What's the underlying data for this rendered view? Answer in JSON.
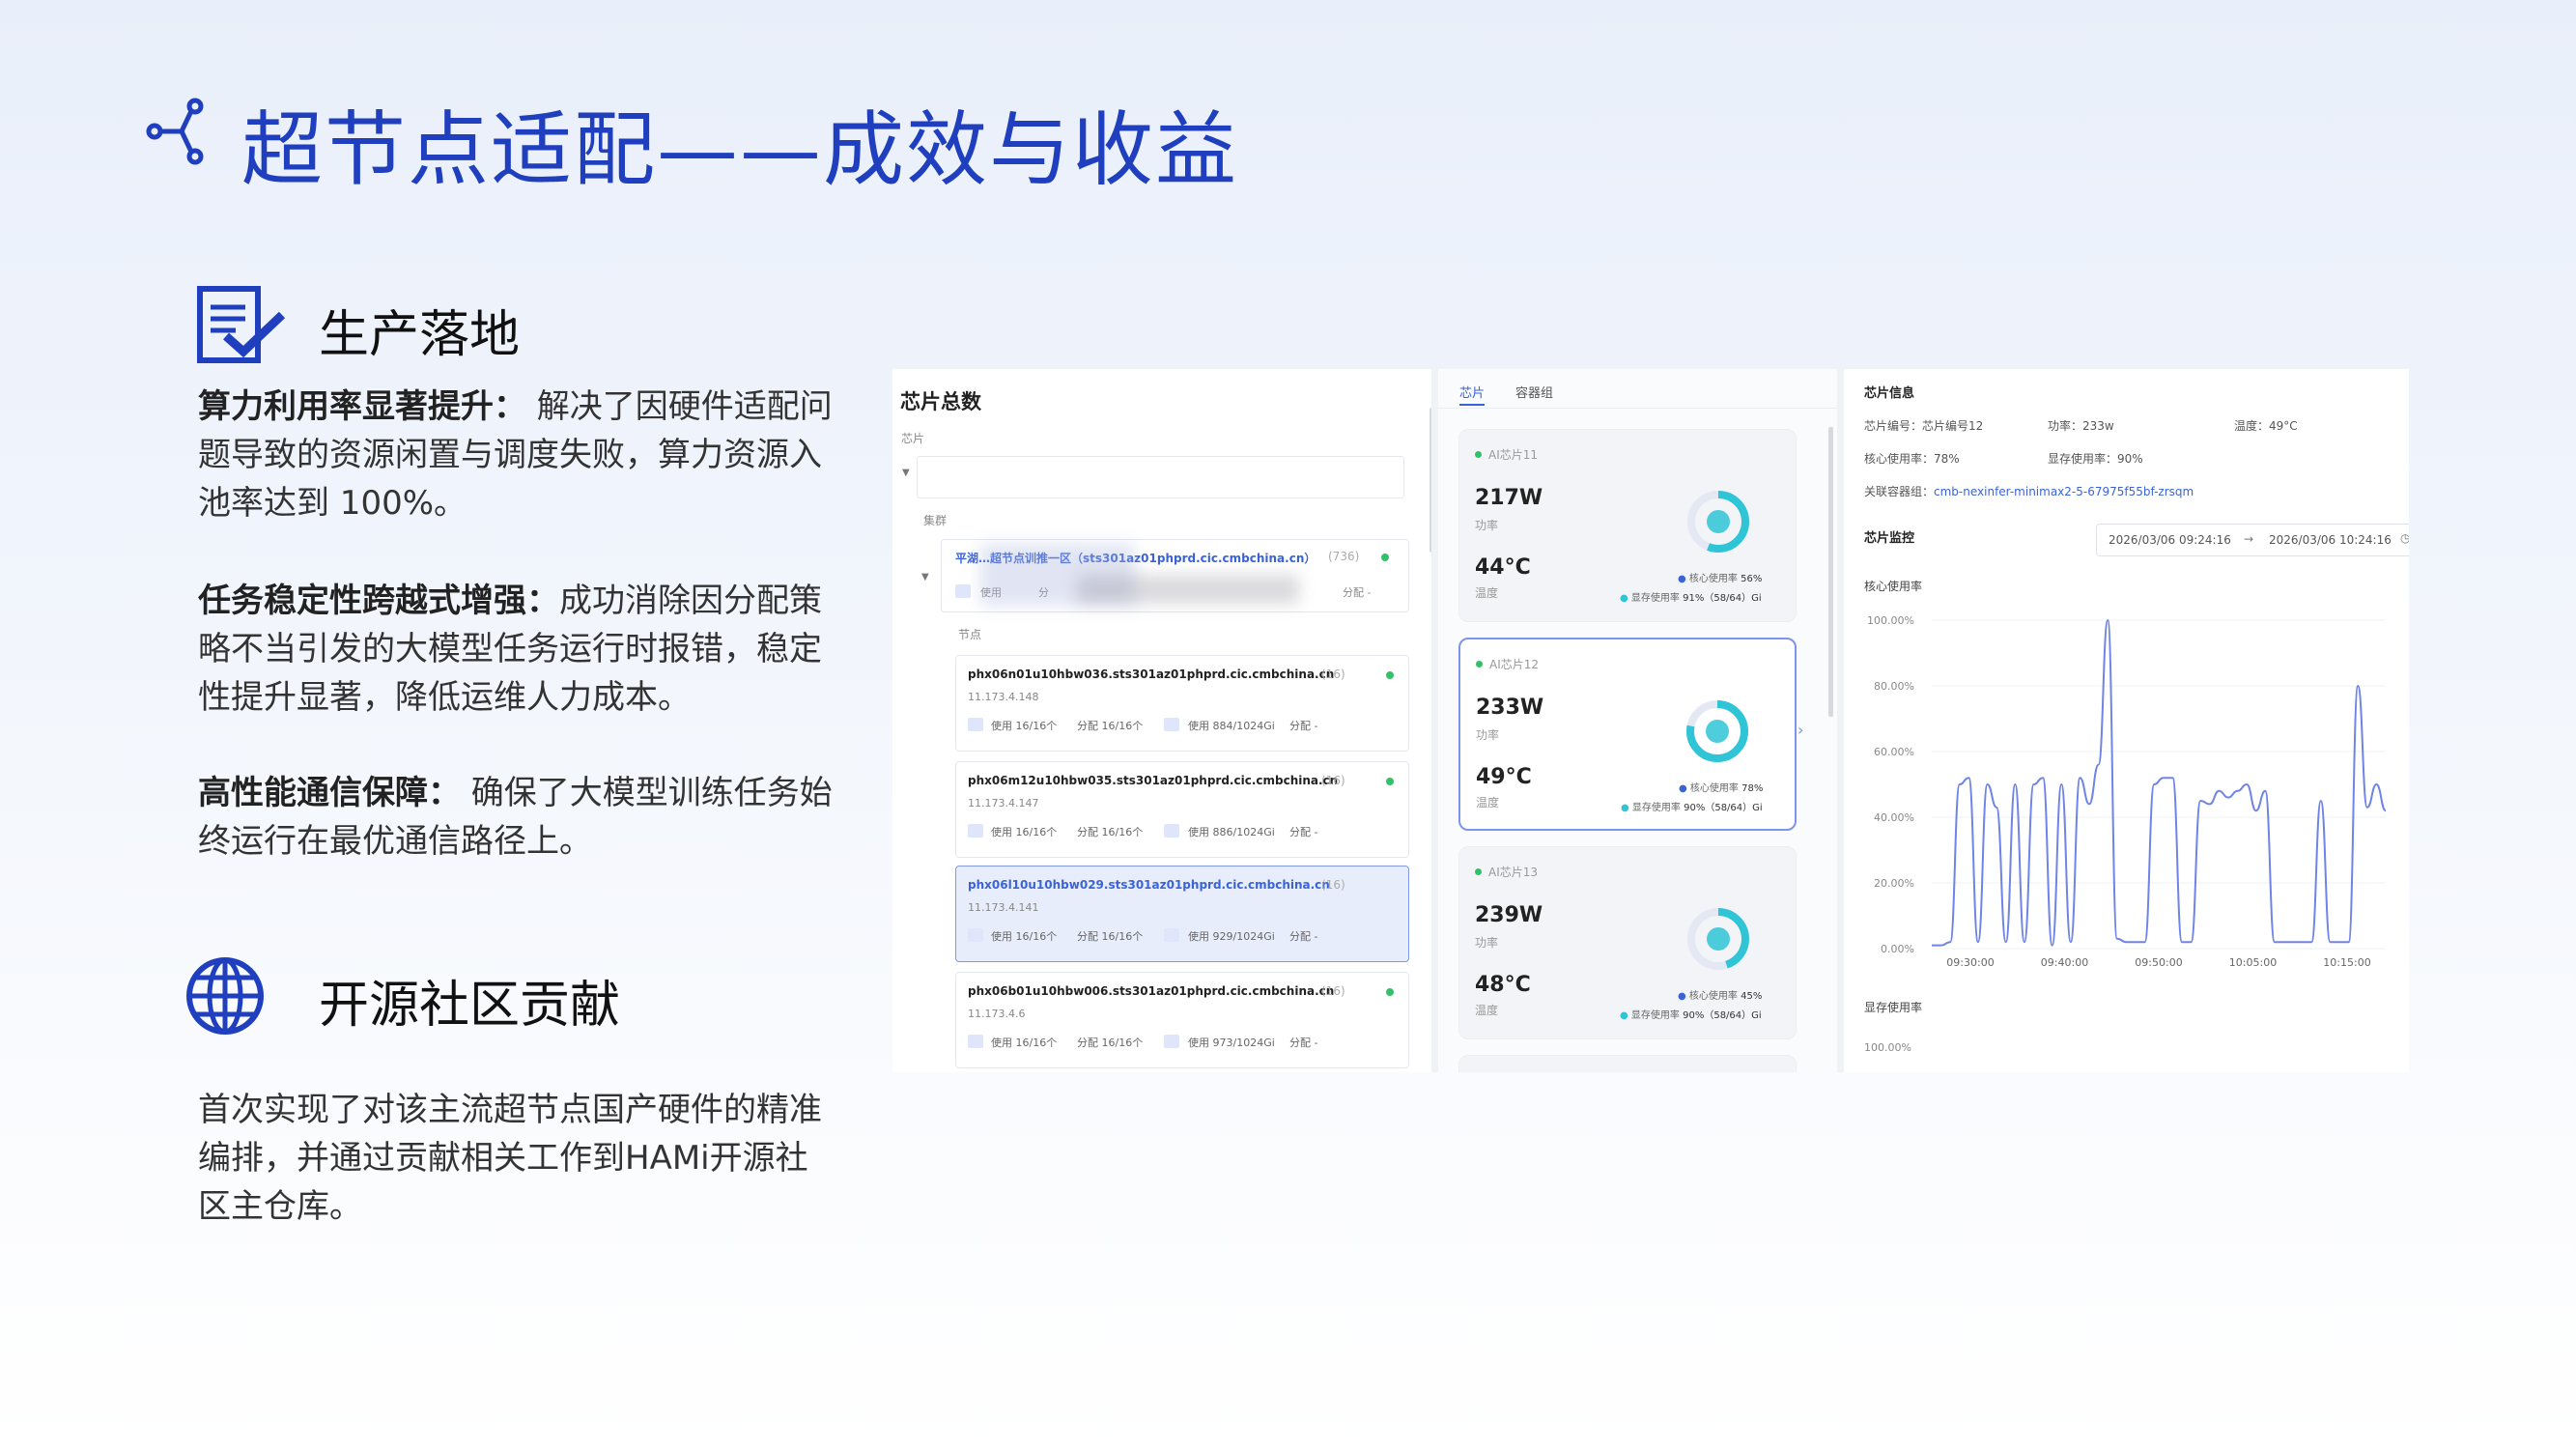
{
  "title": "超节点适配——成效与收益",
  "section1": {
    "heading": "生产落地",
    "items": [
      {
        "label": "算力利用率显著提升：",
        "text": " 解决了因硬件适配问题导致的资源闲置与调度失败，算力资源入池率达到 100%。"
      },
      {
        "label": "任务稳定性跨越式增强：",
        "text": "成功消除因分配策略不当引发的大模型任务运行时报错，稳定性提升显著，降低运维人力成本。"
      },
      {
        "label": "高性能通信保障：",
        "text": " 确保了大模型训练任务始终运行在最优通信路径上。"
      }
    ]
  },
  "section2": {
    "heading": "开源社区贡献",
    "text": "首次实现了对该主流超节点国产硬件的精准编排，并通过贡献相关工作到HAMi开源社区主仓库。"
  },
  "screenshot": {
    "left": {
      "title": "芯片总数",
      "chip_label": "芯片",
      "cluster_label": "集群",
      "cluster": {
        "name": "平湖…超节点训推一区（sts301az01phprd.cic.cmbchina.cn）",
        "count": "(736)",
        "use": "使用",
        "alloc": "分",
        "tail": "分配 -"
      },
      "node_label": "节点",
      "nodes": [
        {
          "name": "phx06n01u10hbw036.sts301az01phprd.cic.cmbchina.cn",
          "count": "(16)",
          "ip": "11.173.4.148",
          "use": "使用 16/16个",
          "alloc": "分配 16/16个",
          "mem": "使用 884/1024Gi",
          "mem_alloc": "分配 -",
          "selected": false
        },
        {
          "name": "phx06m12u10hbw035.sts301az01phprd.cic.cmbchina.cn",
          "count": "(16)",
          "ip": "11.173.4.147",
          "use": "使用 16/16个",
          "alloc": "分配 16/16个",
          "mem": "使用 886/1024Gi",
          "mem_alloc": "分配 -",
          "selected": false
        },
        {
          "name": "phx06l10u10hbw029.sts301az01phprd.cic.cmbchina.cn",
          "count": "(16)",
          "ip": "11.173.4.141",
          "use": "使用 16/16个",
          "alloc": "分配 16/16个",
          "mem": "使用 929/1024Gi",
          "mem_alloc": "分配 -",
          "selected": true
        },
        {
          "name": "phx06b01u10hbw006.sts301az01phprd.cic.cmbchina.cn",
          "count": "(16)",
          "ip": "11.173.4.6",
          "use": "使用 16/16个",
          "alloc": "分配 16/16个",
          "mem": "使用 973/1024Gi",
          "mem_alloc": "分配 -",
          "selected": false
        }
      ]
    },
    "middle": {
      "tabs": [
        "芯片",
        "容器组"
      ],
      "chips": [
        {
          "name": "AI芯片11",
          "power": "217W",
          "power_label": "功率",
          "temp": "44°C",
          "temp_label": "温度",
          "core": "核心使用率",
          "core_val": "56%",
          "mem": "显存使用率",
          "mem_val": "91%（58/64）Gi",
          "core_pct": 0.56,
          "selected": false
        },
        {
          "name": "AI芯片12",
          "power": "233W",
          "power_label": "功率",
          "temp": "49°C",
          "temp_label": "温度",
          "core": "核心使用率",
          "core_val": "78%",
          "mem": "显存使用率",
          "mem_val": "90%（58/64）Gi",
          "core_pct": 0.78,
          "selected": true
        },
        {
          "name": "AI芯片13",
          "power": "239W",
          "power_label": "功率",
          "temp": "48°C",
          "temp_label": "温度",
          "core": "核心使用率",
          "core_val": "45%",
          "mem": "显存使用率",
          "mem_val": "90%（58/64）Gi",
          "core_pct": 0.45,
          "selected": false
        }
      ]
    },
    "right": {
      "info_title": "芯片信息",
      "chip_no": "芯片编号：芯片编号12",
      "power": "功率：233w",
      "temp": "温度：49°C",
      "core": "核心使用率：78%",
      "mem": "显存使用率：90%",
      "container_label": "关联容器组：",
      "container": "cmb-nexinfer-minimax2-5-67975f55bf-zrsqm",
      "monitor_title": "芯片监控",
      "range_start": "2026/03/06 09:24:16",
      "range_sep": "→",
      "range_end": "2026/03/06 10:24:16",
      "chart_title": "核心使用率",
      "chart2_title": "显存使用率",
      "chart2_first_tick": "100.00%"
    },
    "colors": {
      "accent": "#3a63d8",
      "line": "#6f84e6",
      "ok": "#34c06a",
      "ring": "#2fc4d6"
    }
  },
  "chart_data": {
    "type": "line",
    "title": "核心使用率",
    "xlabel": "",
    "ylabel": "",
    "ylim": [
      0,
      100
    ],
    "yticks": [
      "0.00%",
      "20.00%",
      "40.00%",
      "60.00%",
      "80.00%",
      "100.00%"
    ],
    "xticks": [
      "09:30:00",
      "09:40:00",
      "09:50:00",
      "10:05:00",
      "10:15:00"
    ],
    "series": [
      {
        "values": [
          1,
          1,
          2,
          50,
          52,
          2,
          50,
          43,
          2,
          50,
          2,
          50,
          52,
          1,
          50,
          2,
          52,
          44,
          56,
          100,
          3,
          2,
          2,
          2,
          50,
          52,
          52,
          2,
          2,
          45,
          44,
          48,
          46,
          48,
          50,
          42,
          48,
          2,
          2,
          2,
          2,
          2,
          45,
          2,
          2,
          2,
          80,
          43,
          50,
          42
        ]
      }
    ]
  }
}
